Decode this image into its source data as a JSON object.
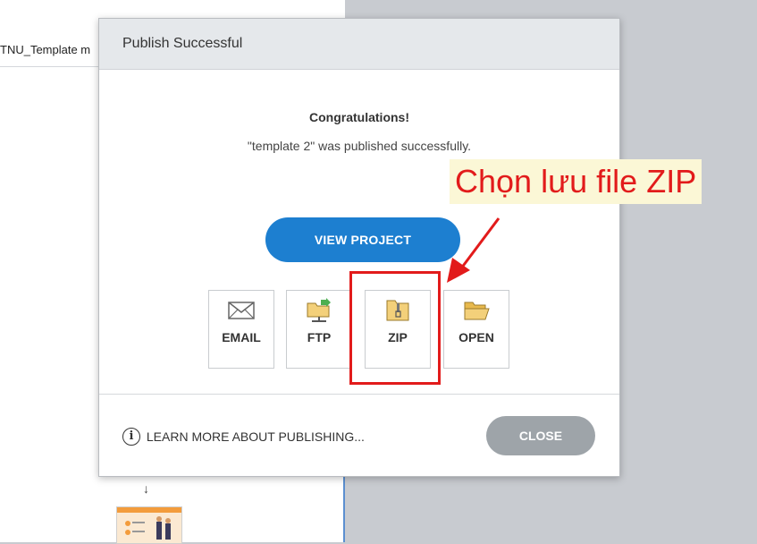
{
  "background": {
    "tab_title": "TNU_Template m",
    "flow_arrow": "↓"
  },
  "dialog": {
    "title": "Publish Successful",
    "congrats": "Congratulations!",
    "message": "\"template 2\" was published successfully.",
    "view_button": "VIEW PROJECT",
    "options": [
      {
        "label": "EMAIL",
        "icon": "envelope-icon"
      },
      {
        "label": "FTP",
        "icon": "ftp-folder-icon"
      },
      {
        "label": "ZIP",
        "icon": "zip-folder-icon"
      },
      {
        "label": "OPEN",
        "icon": "open-folder-icon"
      }
    ],
    "learn_more": "LEARN MORE ABOUT PUBLISHING...",
    "close_button": "CLOSE"
  },
  "annotation": {
    "text": "Chọn lưu file ZIP",
    "color": "#e21b1b"
  },
  "colors": {
    "primary": "#1d7fd0",
    "close_button": "#9ea4a9",
    "header": "#e5e8eb"
  }
}
